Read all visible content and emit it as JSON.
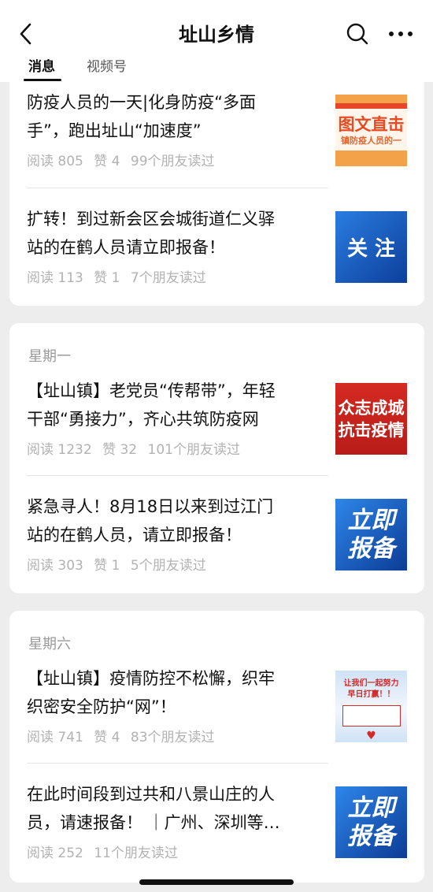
{
  "header": {
    "title": "址山乡情",
    "back_icon": "chevron-left-icon",
    "search_icon": "search-icon",
    "more_icon": "more-dots-icon",
    "tabs": [
      "消息",
      "视频号"
    ]
  },
  "cards": [
    {
      "day": "",
      "articles": [
        {
          "title_lines": [
            "防疫人员的一天|化身防疫“多面",
            "手”，跑出址山“加速度”"
          ],
          "reads": "阅读 805",
          "likes": "赞 4",
          "friends": "99个朋友读过",
          "thumb_lines": [
            "图文直击",
            "镇防疫人员的一"
          ],
          "thumb_colors": [
            "#ffffff",
            "#e9632b"
          ]
        },
        {
          "title_lines": [
            "扩转！到过新会区会城街道仁义驿",
            "站的在鹤人员请立即报备！"
          ],
          "reads": "阅读 113",
          "likes": "赞 1",
          "friends": "7个朋友读过",
          "thumb_lines": [
            "关 注"
          ],
          "thumb_colors": [
            "#1b63c6",
            "#ffffff"
          ]
        }
      ]
    },
    {
      "day": "星期一",
      "articles": [
        {
          "title_lines": [
            "【址山镇】老党员“传帮带”，年轻",
            "干部“勇接力”，齐心共筑防疫网"
          ],
          "reads": "阅读 1232",
          "likes": "赞 32",
          "friends": "101个朋友读过",
          "thumb_lines": [
            "众志成城",
            "抗击疫情"
          ],
          "thumb_colors": [
            "#d42a22",
            "#ffffff"
          ]
        },
        {
          "title_lines": [
            "紧急寻人！8月18日以来到过江门",
            "站的在鹤人员，请立即报备！"
          ],
          "reads": "阅读 303",
          "likes": "赞 1",
          "friends": "5个朋友读过",
          "thumb_lines": [
            "立即",
            "报备"
          ],
          "thumb_colors": [
            "#1656c4",
            "#ffffff"
          ]
        }
      ]
    },
    {
      "day": "星期六",
      "articles": [
        {
          "title_lines": [
            "【址山镇】疫情防控不松懈，织牢",
            "织密安全防护“网”！"
          ],
          "reads": "阅读 741",
          "likes": "赞 4",
          "friends": "83个朋友读过",
          "thumb_lines": [
            "让我们一起努力",
            "早日打赢！！"
          ],
          "thumb_colors": [
            "#e9f1fb",
            "#d32a2a"
          ]
        },
        {
          "title_lines": [
            "在此时间段到过共和八景山庄的人",
            "员，请速报备！ ｜广州、深圳等…"
          ],
          "reads": "阅读 252",
          "likes": "",
          "friends": "11个朋友读过",
          "thumb_lines": [
            "立即",
            "报备"
          ],
          "thumb_colors": [
            "#1656c4",
            "#ffffff"
          ]
        }
      ]
    }
  ]
}
